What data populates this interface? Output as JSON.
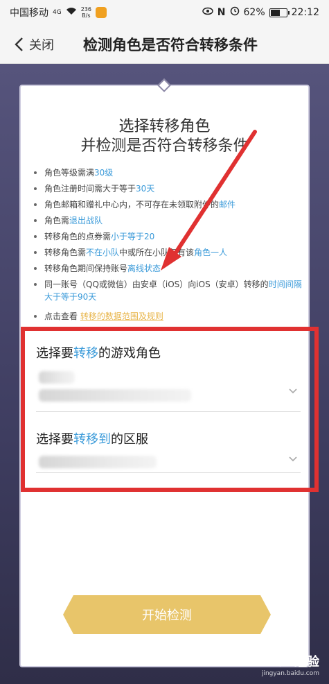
{
  "status": {
    "carrier": "中国移动",
    "signal": "4G",
    "net_speed_top": "236",
    "net_speed_bottom": "B/s",
    "nfc": "N",
    "battery": "62%",
    "battery_level": 0.62,
    "time": "22:12"
  },
  "header": {
    "close_label": "关闭",
    "title": "检测角色是否符合转移条件"
  },
  "card": {
    "title_line1": "选择转移角色",
    "title_line2": "并检测是否符合转移条件"
  },
  "rules": [
    {
      "pre": "角色等级需满",
      "hl": "30级",
      "post": ""
    },
    {
      "pre": "角色注册时间需大于等于",
      "hl": "30天",
      "post": ""
    },
    {
      "pre": "角色邮箱和赠礼中心内，不可存在未领取附件的",
      "hl": "邮件",
      "post": ""
    },
    {
      "pre": "角色需",
      "hl": "退出战队",
      "post": ""
    },
    {
      "pre": "转移角色的点券需",
      "hl": "小于等于20",
      "post": ""
    },
    {
      "pre": "转移角色需",
      "hl": "不在小队",
      "post": "中或所在小队仅有该",
      "hl2": "角色一人"
    },
    {
      "pre": "转移角色期间保持账号",
      "hl": "离线状态",
      "post": ""
    },
    {
      "pre": "同一账号（QQ或微信）由安卓（iOS）向iOS（安卓）转移的",
      "hl": "时间间隔大于等于90天",
      "post": ""
    }
  ],
  "link": {
    "pre": "点击查看",
    "text": "转移的数据范围及规则"
  },
  "select_role": {
    "label_pre": "选择要",
    "label_hl": "转移",
    "label_post": "的游戏角色"
  },
  "select_server": {
    "label_pre": "选择要",
    "label_hl": "转移到",
    "label_post": "的区服"
  },
  "start_button": "开始检测",
  "watermark": {
    "brand": "Bai 经验",
    "url": "jingyan.baidu.com"
  },
  "colors": {
    "highlight": "#3a9ad9",
    "button": "#e8c56a",
    "annotation": "#e03131"
  }
}
